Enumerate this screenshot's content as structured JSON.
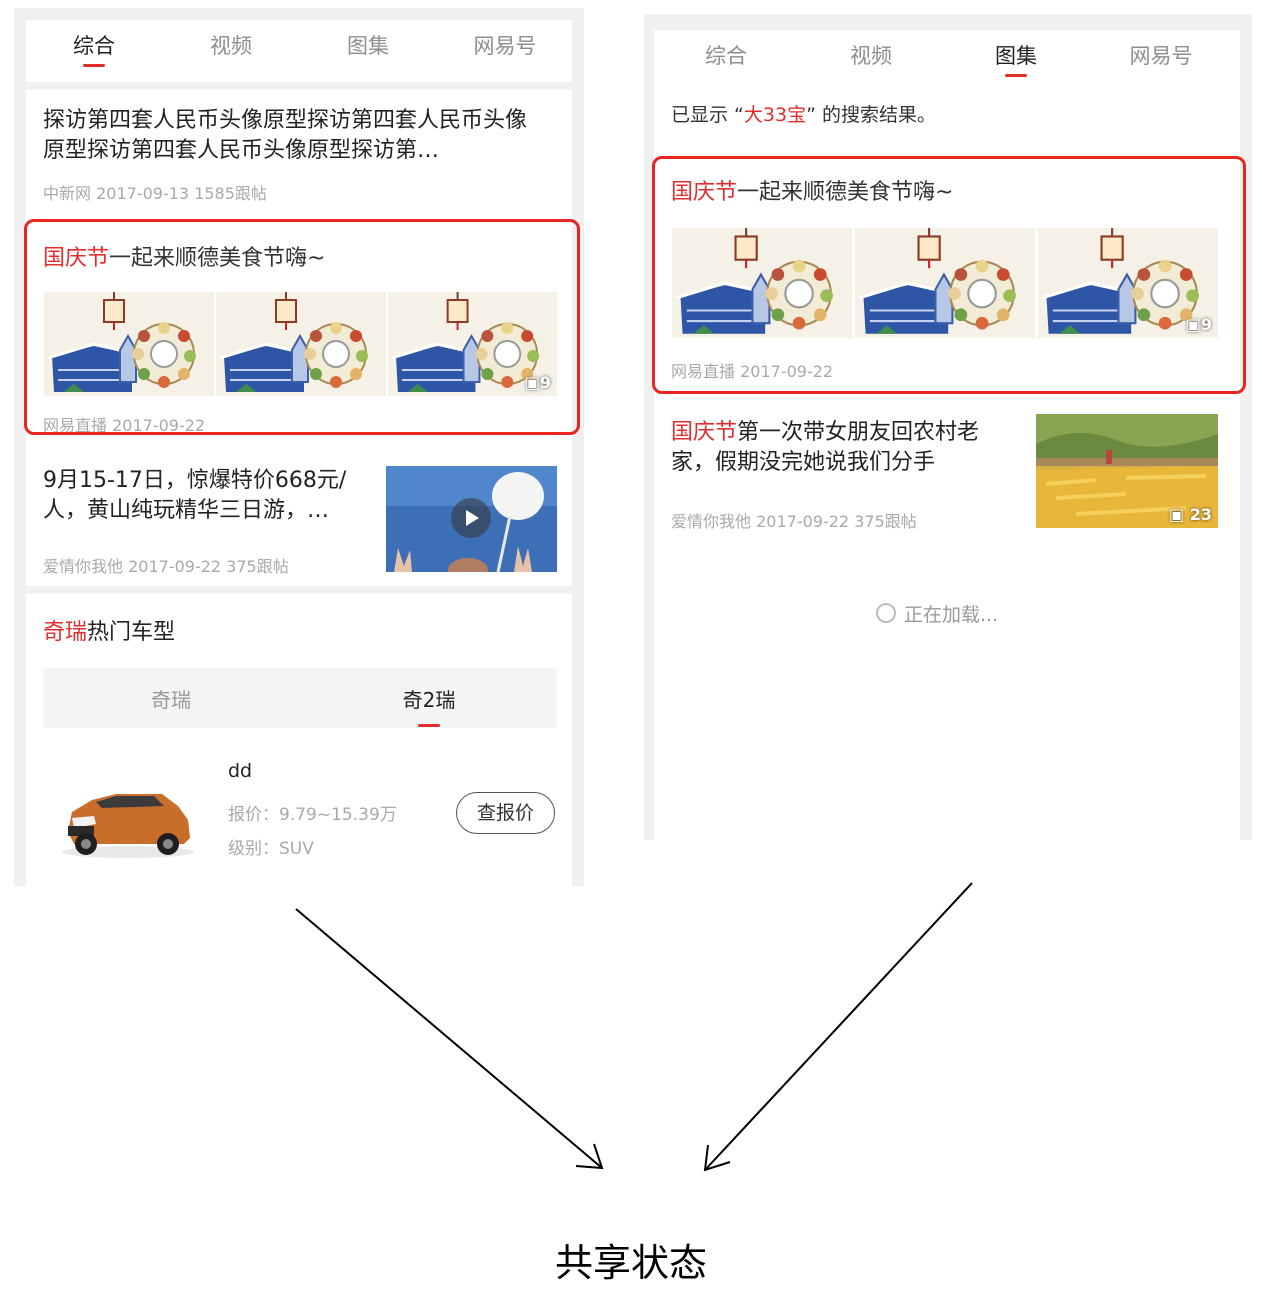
{
  "left": {
    "tabs": [
      "综合",
      "视频",
      "图集",
      "网易号"
    ],
    "active_tab": 0,
    "article1": {
      "title": "探访第四套人民币头像原型探访第四套人民币头像原型探访第四套人民币头像原型探访第…",
      "source": "中新网",
      "date": "2017-09-13",
      "comments": "1585跟帖"
    },
    "gallery": {
      "title_highlight": "国庆节",
      "title_rest": "一起来顺德美食节嗨~",
      "count": "9",
      "source": "网易直播",
      "date": "2017-09-22"
    },
    "article2": {
      "title": "9月15-17日，惊爆特价668元/人，黄山纯玩精华三日游，…",
      "source": "爱情你我他",
      "date": "2017-09-22",
      "comments": "375跟帖"
    },
    "car": {
      "brand_highlight": "奇瑞",
      "heading_rest": "热门车型",
      "subtabs": [
        "奇瑞",
        "奇2瑞"
      ],
      "active_subtab": 1,
      "model": "dd",
      "price_label": "报价：",
      "price": "9.79~15.39万",
      "level_label": "级别：",
      "level": "SUV",
      "button": "查报价"
    }
  },
  "right": {
    "tabs": [
      "综合",
      "视频",
      "图集",
      "网易号"
    ],
    "active_tab": 2,
    "search_prefix": "已显示 “",
    "search_term": "大33宝",
    "search_suffix": "” 的搜索结果。",
    "gallery": {
      "title_highlight": "国庆节",
      "title_rest": "一起来顺德美食节嗨~",
      "count": "9",
      "source": "网易直播",
      "date": "2017-09-22"
    },
    "article": {
      "title_highlight": "国庆节",
      "title_rest": "第一次带女朋友回农村老家，假期没完她说我们分手",
      "count": "23",
      "source": "爱情你我他",
      "date": "2017-09-22",
      "comments": "375跟帖"
    },
    "loading": "正在加载..."
  },
  "caption": "共享状态",
  "colors": {
    "highlight": "#e02e2e",
    "box": "#e8251f"
  }
}
